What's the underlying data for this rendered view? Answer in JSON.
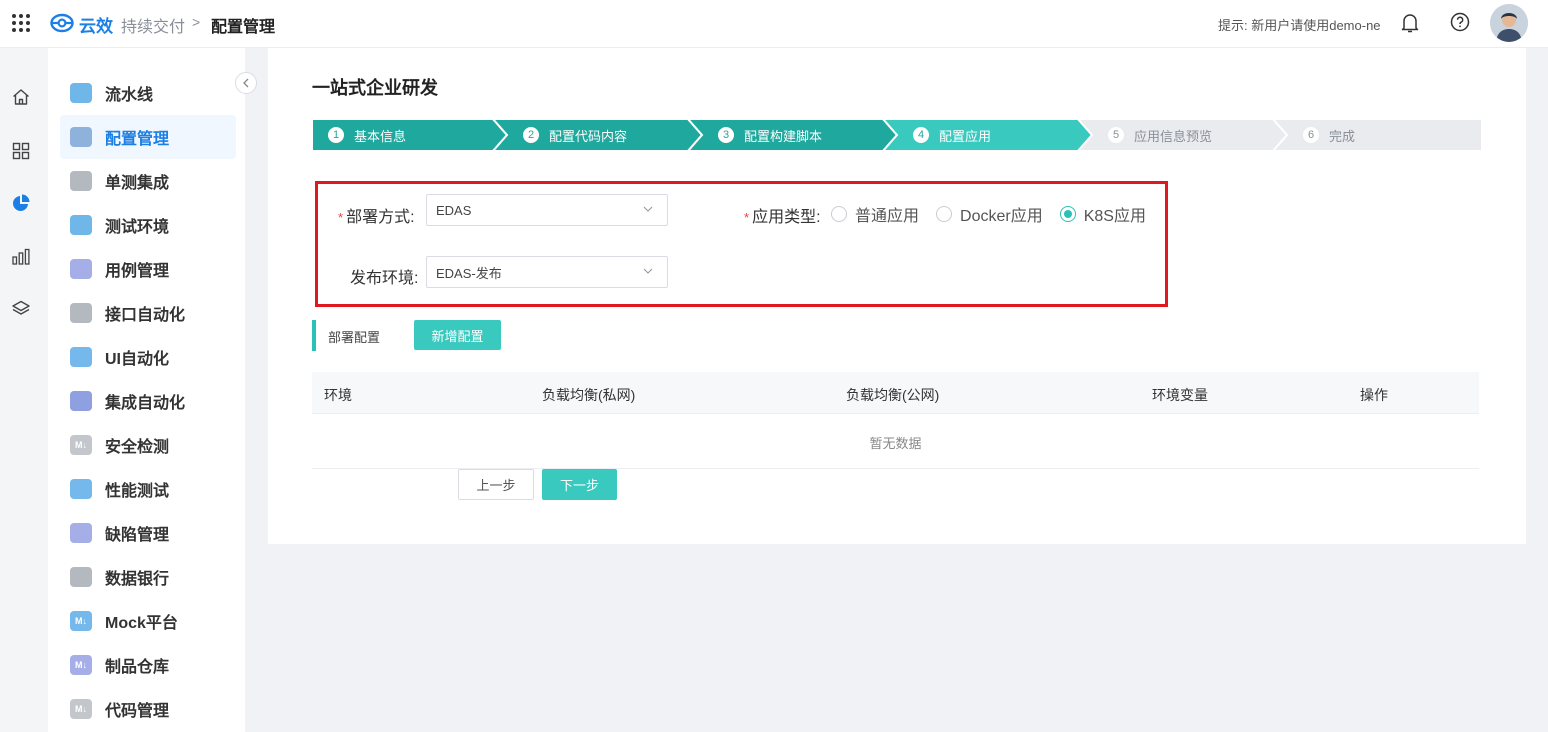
{
  "header": {
    "brand": "云效",
    "breadcrumb": [
      "持续交付",
      "配置管理"
    ],
    "separator": ">",
    "hint": "提示: 新用户请使用demo-ne",
    "icons": [
      "apps-grid-icon",
      "yunxiao-logo-icon",
      "bell-icon",
      "help-icon",
      "user-avatar"
    ]
  },
  "rail": {
    "icons": [
      "home-icon",
      "dashboard-icon",
      "pie-chart-icon",
      "bar-chart-icon",
      "layers-icon"
    ],
    "active": "pie-chart-icon"
  },
  "sidebar": {
    "items": [
      {
        "label": "流水线",
        "icon": "pipeline-icon",
        "color": "#6fb7e8"
      },
      {
        "label": "配置管理",
        "icon": "wrench-icon",
        "color": "#8fb2dd",
        "active": true
      },
      {
        "label": "单测集成",
        "icon": "play-icon",
        "color": "#b4b9c0"
      },
      {
        "label": "测试环境",
        "icon": "cloud-icon",
        "color": "#6fb7e8"
      },
      {
        "label": "用例管理",
        "icon": "inbox-icon",
        "color": "#a6aee8"
      },
      {
        "label": "接口自动化",
        "icon": "api-icon",
        "color": "#b4b9c0"
      },
      {
        "label": "UI自动化",
        "icon": "ui-icon",
        "color": "#74b8ec"
      },
      {
        "label": "集成自动化",
        "icon": "integration-icon",
        "color": "#8fa0e0"
      },
      {
        "label": "安全检测",
        "icon": "markdown-icon",
        "color": "#c3c7cc"
      },
      {
        "label": "性能测试",
        "icon": "chart-icon",
        "color": "#74b8ec"
      },
      {
        "label": "缺陷管理",
        "icon": "bug-icon",
        "color": "#a6aee8"
      },
      {
        "label": "数据银行",
        "icon": "target-icon",
        "color": "#b4b9c0"
      },
      {
        "label": "Mock平台",
        "icon": "markdown-icon",
        "color": "#74b8ec"
      },
      {
        "label": "制品仓库",
        "icon": "markdown-icon",
        "color": "#a6aee8"
      },
      {
        "label": "代码管理",
        "icon": "markdown-icon",
        "color": "#c3c7cc"
      }
    ],
    "icon_text": "M↓"
  },
  "main": {
    "title": "一站式企业研发",
    "steps": [
      {
        "num": "1",
        "label": "基本信息",
        "state": "done"
      },
      {
        "num": "2",
        "label": "配置代码内容",
        "state": "done"
      },
      {
        "num": "3",
        "label": "配置构建脚本",
        "state": "done"
      },
      {
        "num": "4",
        "label": "配置应用",
        "state": "current"
      },
      {
        "num": "5",
        "label": "应用信息预览",
        "state": "todo"
      },
      {
        "num": "6",
        "label": "完成",
        "state": "todo"
      }
    ],
    "form": {
      "deploy_label": "部署方式:",
      "deploy_value": "EDAS",
      "app_type_label": "应用类型:",
      "app_types": [
        "普通应用",
        "Docker应用",
        "K8S应用"
      ],
      "app_type_selected": "K8S应用",
      "env_label": "发布环境:",
      "env_value": "EDAS-发布",
      "required_mark": "*"
    },
    "deploy_section": {
      "label": "部署配置",
      "add_button": "新增配置"
    },
    "table": {
      "columns": [
        "环境",
        "负载均衡(私网)",
        "负载均衡(公网)",
        "环境变量",
        "操作"
      ],
      "empty_text": "暂无数据"
    },
    "buttons": {
      "prev": "上一步",
      "next": "下一步"
    }
  },
  "colors": {
    "brand": "#1b7fe5",
    "step_done": "#1fa89d",
    "step_current": "#3ac9be",
    "step_todo": "#e9ebee",
    "highlight_border": "#e0191f"
  }
}
